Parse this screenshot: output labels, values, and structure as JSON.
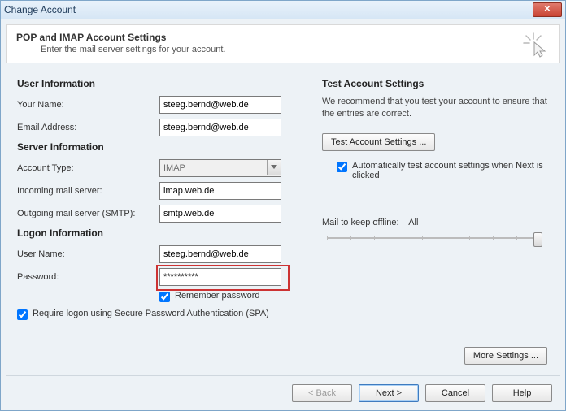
{
  "window": {
    "title": "Change Account"
  },
  "header": {
    "title": "POP and IMAP Account Settings",
    "subtitle": "Enter the mail server settings for your account."
  },
  "sections": {
    "user": "User Information",
    "server": "Server Information",
    "logon": "Logon Information",
    "test": "Test Account Settings"
  },
  "labels": {
    "your_name": "Your Name:",
    "email": "Email Address:",
    "account_type": "Account Type:",
    "incoming": "Incoming mail server:",
    "outgoing": "Outgoing mail server (SMTP):",
    "user_name": "User Name:",
    "password": "Password:",
    "remember": "Remember password",
    "require_spa": "Require logon using Secure Password Authentication (SPA)",
    "test_blurb": "We recommend that you test your account to ensure that the entries are correct.",
    "auto_test": "Automatically test account settings when Next is clicked",
    "mail_keep": "Mail to keep offline:",
    "mail_keep_val": "All"
  },
  "values": {
    "your_name": "steeg.bernd@web.de",
    "email": "steeg.bernd@web.de",
    "account_type": "IMAP",
    "incoming": "imap.web.de",
    "outgoing": "smtp.web.de",
    "user_name": "steeg.bernd@web.de",
    "password": "**********",
    "remember": true,
    "require_spa": true,
    "auto_test": true
  },
  "buttons": {
    "test": "Test Account Settings ...",
    "more": "More Settings ...",
    "back": "< Back",
    "next": "Next >",
    "cancel": "Cancel",
    "help": "Help"
  }
}
